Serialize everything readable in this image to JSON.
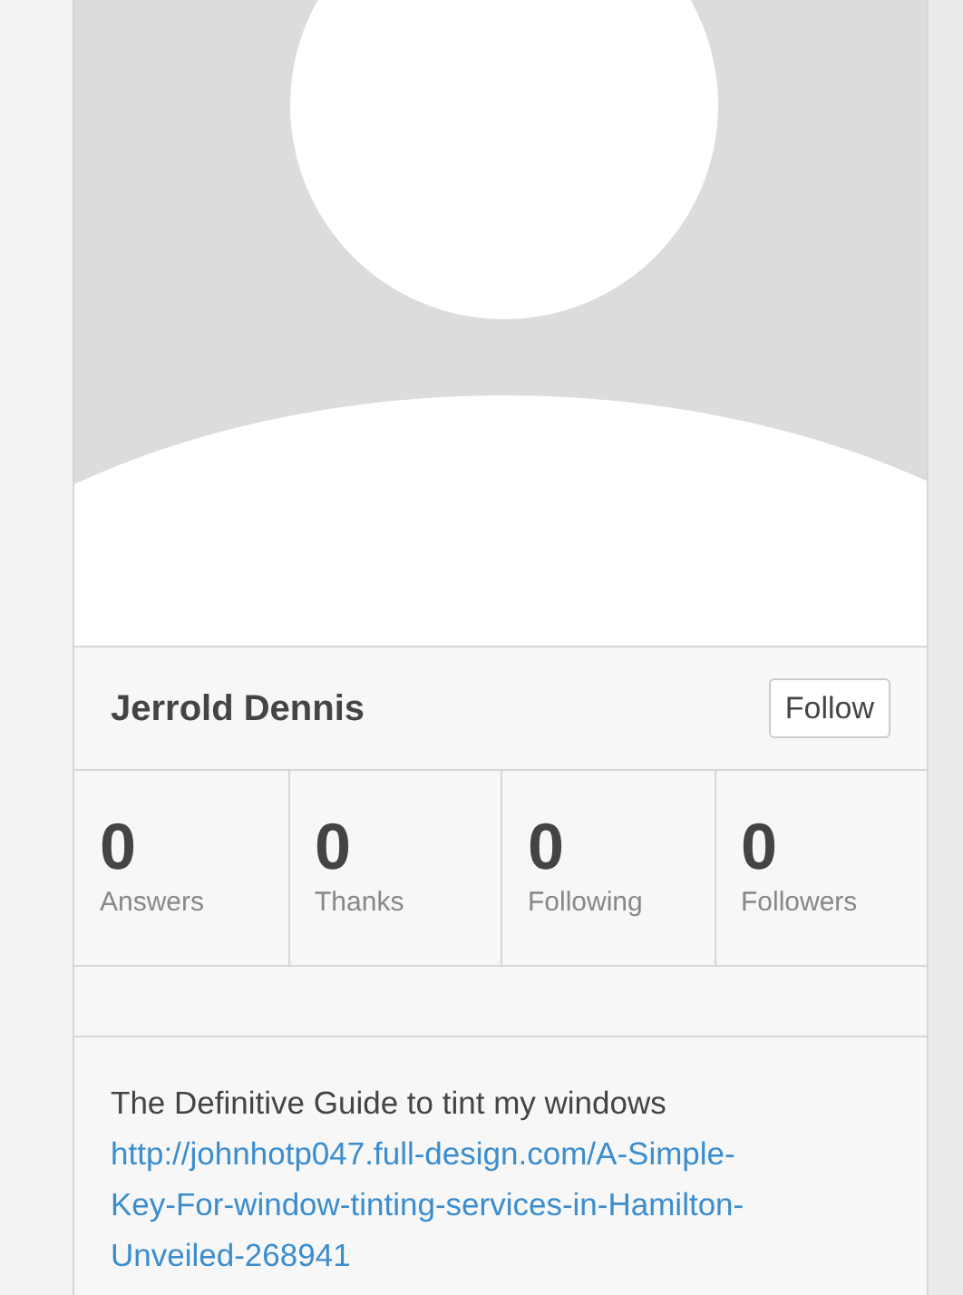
{
  "profile": {
    "name": "Jerrold Dennis",
    "follow_button": "Follow"
  },
  "stats": [
    {
      "value": "0",
      "label": "Answers"
    },
    {
      "value": "0",
      "label": "Thanks"
    },
    {
      "value": "0",
      "label": "Following"
    },
    {
      "value": "0",
      "label": "Followers"
    }
  ],
  "bio": {
    "title": "The Definitive Guide to tint my windows",
    "link": "http://johnhotp047.full-design.com/A-Simple-Key-For-window-tinting-services-in-Hamilton-Unveiled-268941"
  }
}
